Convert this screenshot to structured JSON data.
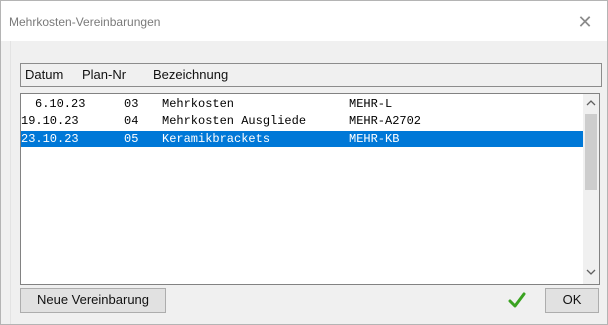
{
  "window": {
    "title": "Mehrkosten-Vereinbarungen",
    "close_glyph": "✕"
  },
  "table": {
    "columns": [
      "Datum",
      "Plan-Nr",
      "Bezeichnung"
    ],
    "rows": [
      {
        "datum": "6.10.23",
        "plan_nr": "03",
        "bezeichnung": "Mehrkosten",
        "code": "MEHR-L",
        "selected": false
      },
      {
        "datum": "19.10.23",
        "plan_nr": "04",
        "bezeichnung": "Mehrkosten Ausgliede",
        "code": "MEHR-A2702",
        "selected": false
      },
      {
        "datum": "23.10.23",
        "plan_nr": "05",
        "bezeichnung": "Keramikbrackets",
        "code": "MEHR-KB",
        "selected": true
      }
    ]
  },
  "scrollbar": {
    "up_icon": "chevron-up-icon",
    "down_icon": "chevron-down-icon"
  },
  "buttons": {
    "new_label": "Neue Vereinbarung",
    "ok_label": "OK"
  },
  "colors": {
    "selection": "#0078d7",
    "check": "#3aa321"
  }
}
